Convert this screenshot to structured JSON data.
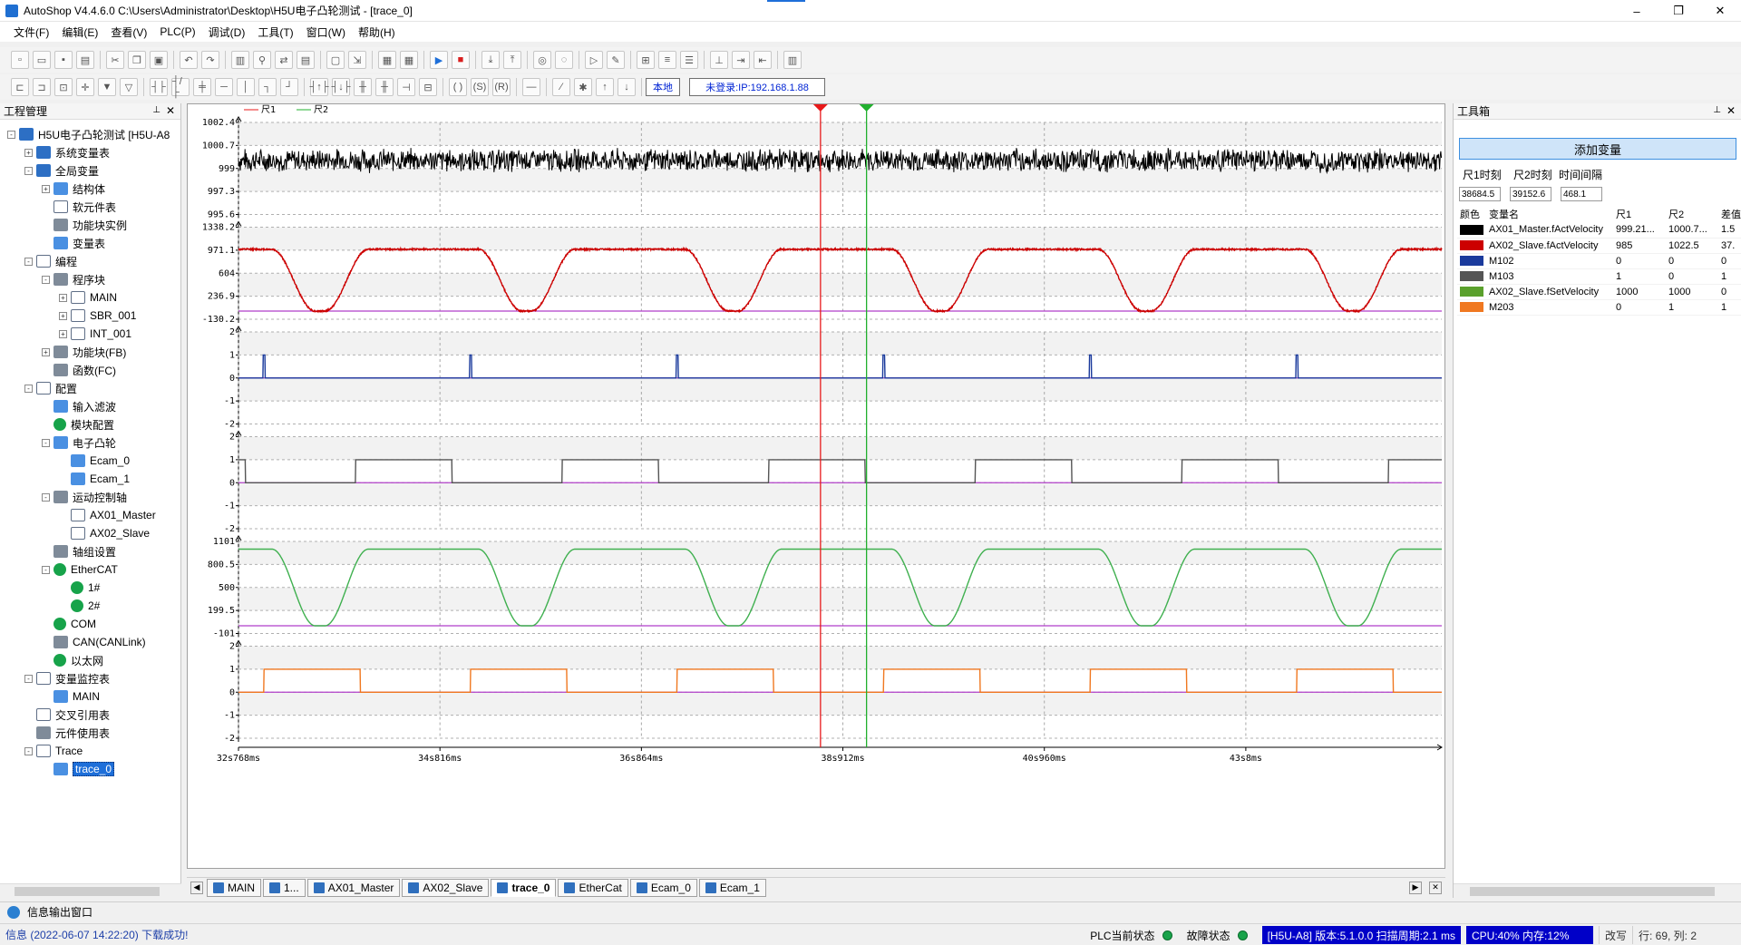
{
  "window": {
    "title": "AutoShop V4.4.6.0  C:\\Users\\Administrator\\Desktop\\H5U电子凸轮测试 - [trace_0]",
    "controls": [
      "–",
      "❐",
      "✕"
    ]
  },
  "menu": [
    "文件(F)",
    "编辑(E)",
    "查看(V)",
    "PLC(P)",
    "调试(D)",
    "工具(T)",
    "窗口(W)",
    "帮助(H)"
  ],
  "toolbar": {
    "local_label": "本地",
    "login_label": "未登录:IP:192.168.1.88"
  },
  "left_panel": {
    "title": "工程管理",
    "tree": [
      {
        "label": "H5U电子凸轮测试 [H5U-A8",
        "level": 0,
        "exp": "-",
        "icon": "blue"
      },
      {
        "label": "系统变量表",
        "level": 1,
        "exp": "+",
        "icon": "blue"
      },
      {
        "label": "全局变量",
        "level": 1,
        "exp": "-",
        "icon": "blue"
      },
      {
        "label": "结构体",
        "level": 2,
        "exp": "+",
        "icon": "lightblue"
      },
      {
        "label": "软元件表",
        "level": 2,
        "exp": "",
        "icon": "doc"
      },
      {
        "label": "功能块实例",
        "level": 2,
        "exp": "",
        "icon": "grey"
      },
      {
        "label": "变量表",
        "level": 2,
        "exp": "",
        "icon": "lightblue"
      },
      {
        "label": "编程",
        "level": 1,
        "exp": "-",
        "icon": "doc"
      },
      {
        "label": "程序块",
        "level": 2,
        "exp": "-",
        "icon": "grey"
      },
      {
        "label": "MAIN",
        "level": 3,
        "exp": "+",
        "icon": "doc"
      },
      {
        "label": "SBR_001",
        "level": 3,
        "exp": "+",
        "icon": "doc"
      },
      {
        "label": "INT_001",
        "level": 3,
        "exp": "+",
        "icon": "doc"
      },
      {
        "label": "功能块(FB)",
        "level": 2,
        "exp": "+",
        "icon": "grey"
      },
      {
        "label": "函数(FC)",
        "level": 2,
        "exp": "",
        "icon": "grey"
      },
      {
        "label": "配置",
        "level": 1,
        "exp": "-",
        "icon": "doc"
      },
      {
        "label": "输入滤波",
        "level": 2,
        "exp": "",
        "icon": "lightblue"
      },
      {
        "label": "模块配置",
        "level": 2,
        "exp": "",
        "icon": "green"
      },
      {
        "label": "电子凸轮",
        "level": 2,
        "exp": "-",
        "icon": "lightblue"
      },
      {
        "label": "Ecam_0",
        "level": 3,
        "exp": "",
        "icon": "lightblue"
      },
      {
        "label": "Ecam_1",
        "level": 3,
        "exp": "",
        "icon": "lightblue"
      },
      {
        "label": "运动控制轴",
        "level": 2,
        "exp": "-",
        "icon": "grey"
      },
      {
        "label": "AX01_Master",
        "level": 3,
        "exp": "",
        "icon": "doc"
      },
      {
        "label": "AX02_Slave",
        "level": 3,
        "exp": "",
        "icon": "doc"
      },
      {
        "label": "轴组设置",
        "level": 2,
        "exp": "",
        "icon": "grey"
      },
      {
        "label": "EtherCAT",
        "level": 2,
        "exp": "-",
        "icon": "green"
      },
      {
        "label": "1#",
        "level": 3,
        "exp": "",
        "icon": "green"
      },
      {
        "label": "2#",
        "level": 3,
        "exp": "",
        "icon": "green"
      },
      {
        "label": "COM",
        "level": 2,
        "exp": "",
        "icon": "green"
      },
      {
        "label": "CAN(CANLink)",
        "level": 2,
        "exp": "",
        "icon": "grey"
      },
      {
        "label": "以太网",
        "level": 2,
        "exp": "",
        "icon": "green"
      },
      {
        "label": "变量监控表",
        "level": 1,
        "exp": "-",
        "icon": "doc"
      },
      {
        "label": "MAIN",
        "level": 2,
        "exp": "",
        "icon": "lightblue"
      },
      {
        "label": "交叉引用表",
        "level": 1,
        "exp": "",
        "icon": "doc"
      },
      {
        "label": "元件使用表",
        "level": 1,
        "exp": "",
        "icon": "grey"
      },
      {
        "label": "Trace",
        "level": 1,
        "exp": "-",
        "icon": "doc"
      },
      {
        "label": "trace_0",
        "level": 2,
        "exp": "",
        "icon": "lightblue",
        "selected": true
      }
    ]
  },
  "right_panel": {
    "title": "工具箱",
    "add_var_label": "添加变量",
    "rule1_time_label": "尺1时刻",
    "rule2_time_label": "尺2时刻",
    "interval_label": "时间间隔",
    "rule1_time": "38684.5",
    "rule2_time": "39152.6",
    "interval": "468.1",
    "columns": [
      "颜色",
      "变量名",
      "尺1",
      "尺2",
      "差值"
    ],
    "variables": [
      {
        "color": "#000000",
        "name": "AX01_Master.fActVelocity",
        "r1": "999.21...",
        "r2": "1000.7...",
        "diff": "1.5"
      },
      {
        "color": "#cc0000",
        "name": "AX02_Slave.fActVelocity",
        "r1": "985",
        "r2": "1022.5",
        "diff": "37."
      },
      {
        "color": "#1a3a9c",
        "name": "M102",
        "r1": "0",
        "r2": "0",
        "diff": "0"
      },
      {
        "color": "#555555",
        "name": "M103",
        "r1": "1",
        "r2": "0",
        "diff": "1"
      },
      {
        "color": "#5aa02c",
        "name": "AX02_Slave.fSetVelocity",
        "r1": "1000",
        "r2": "1000",
        "diff": "0"
      },
      {
        "color": "#f07820",
        "name": "M203",
        "r1": "0",
        "r2": "1",
        "diff": "1"
      }
    ]
  },
  "chart_data": {
    "type": "line",
    "legend": [
      "尺1",
      "尺2"
    ],
    "x_ticks": [
      "32s768ms",
      "34s816ms",
      "36s864ms",
      "38s912ms",
      "40s960ms",
      "43s8ms"
    ],
    "x_tick_ms": [
      32768,
      34816,
      36864,
      38912,
      40960,
      43008
    ],
    "x_range_ms": [
      32768,
      45000
    ],
    "cursors_ms": {
      "rule1": 38684.5,
      "rule2": 39152.6
    },
    "cursor_colors": {
      "rule1": "#e8191a",
      "rule2": "#21b02e"
    },
    "period_ms": 2100,
    "plots": [
      {
        "name": "AX01_Master.fActVelocity",
        "color": "#000000",
        "ticks": [
          "1002.4",
          "1000.7",
          "999",
          "997.3",
          "995.6"
        ],
        "tick_values": [
          1002.4,
          1000.7,
          999,
          997.3,
          995.6
        ],
        "ylim": [
          995.6,
          1002.4
        ],
        "kind": "noise",
        "center": 999.6,
        "amplitude": 0.8
      },
      {
        "name": "AX02_Slave.fActVelocity",
        "color": "#cc0000",
        "ticks": [
          "1338.2",
          "971.1",
          "604",
          "236.9",
          "-130.2"
        ],
        "tick_values": [
          1338.2,
          971.1,
          604,
          236.9,
          -130.2
        ],
        "ylim": [
          -130.2,
          1338.2
        ],
        "kind": "cam",
        "low": 0,
        "high": 985
      },
      {
        "name": "M102",
        "color": "#1a3a9c",
        "ticks": [
          "2",
          "1",
          "0",
          "-1",
          "-2"
        ],
        "tick_values": [
          2,
          1,
          0,
          -1,
          -2
        ],
        "ylim": [
          -2,
          2
        ],
        "kind": "pulse"
      },
      {
        "name": "M103",
        "color": "#555555",
        "ticks": [
          "2",
          "1",
          "0",
          "-1",
          "-2"
        ],
        "tick_values": [
          2,
          1,
          0,
          -1,
          -2
        ],
        "ylim": [
          -2,
          2
        ],
        "kind": "square",
        "phase": 0.0
      },
      {
        "name": "AX02_Slave.fSetVelocity",
        "color": "#3fb04f",
        "ticks": [
          "1101",
          "800.5",
          "500",
          "199.5",
          "-101"
        ],
        "tick_values": [
          1101,
          800.5,
          500,
          199.5,
          -101
        ],
        "ylim": [
          -101,
          1101
        ],
        "kind": "cam",
        "low": 0,
        "high": 1000
      },
      {
        "name": "M203",
        "color": "#f07820",
        "ticks": [
          "2",
          "1",
          "0",
          "-1",
          "-2"
        ],
        "tick_values": [
          2,
          1,
          0,
          -1,
          -2
        ],
        "ylim": [
          -2,
          2
        ],
        "kind": "square",
        "phase": 0.0
      }
    ]
  },
  "tabs": [
    {
      "label": "MAIN",
      "active": false
    },
    {
      "label": "1...",
      "active": false
    },
    {
      "label": "AX01_Master",
      "active": false
    },
    {
      "label": "AX02_Slave",
      "active": false
    },
    {
      "label": "trace_0",
      "active": true
    },
    {
      "label": "EtherCat",
      "active": false
    },
    {
      "label": "Ecam_0",
      "active": false
    },
    {
      "label": "Ecam_1",
      "active": false
    }
  ],
  "info": {
    "window_label": "信息输出窗口",
    "status_message": "信息    (2022-06-07 14:22:20)  下载成功!",
    "plc_state_label": "PLC当前状态",
    "fault_label": "故障状态",
    "device_info": "[H5U-A8] 版本:5.1.0.0 扫描周期:2.1 ms",
    "cpu_info": "CPU:40%  内存:12%",
    "mode": "改写",
    "position": "行:  69, 列:   2"
  }
}
